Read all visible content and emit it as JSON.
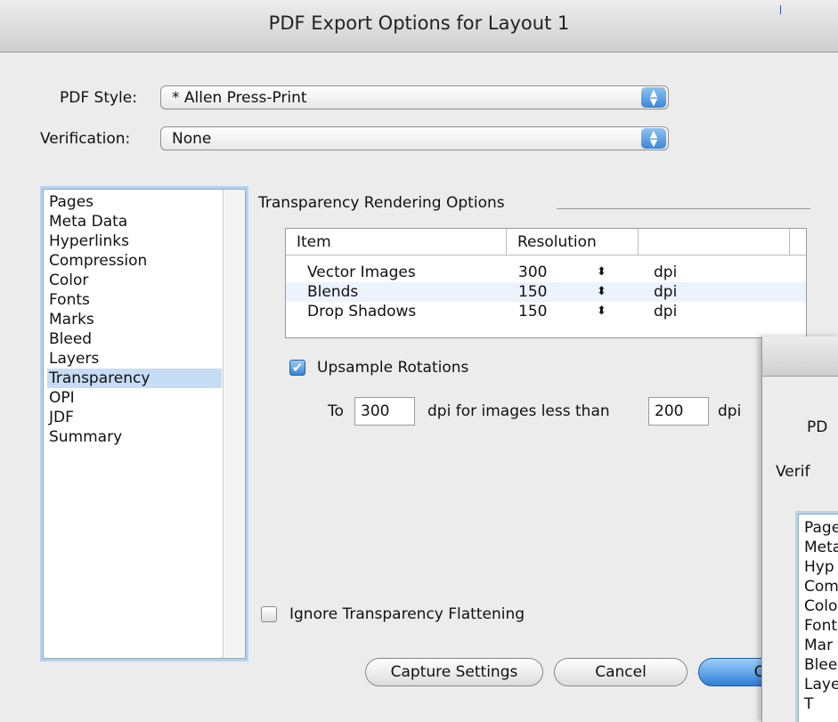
{
  "window": {
    "title": "PDF Export Options for Layout 1"
  },
  "pdf_style": {
    "label": "PDF Style:",
    "value": "* Allen Press-Print"
  },
  "verification": {
    "label": "Verification:",
    "value": "None"
  },
  "categories": [
    {
      "label": "Pages"
    },
    {
      "label": "Meta Data"
    },
    {
      "label": "Hyperlinks"
    },
    {
      "label": "Compression"
    },
    {
      "label": "Color"
    },
    {
      "label": "Fonts"
    },
    {
      "label": "Marks"
    },
    {
      "label": "Bleed"
    },
    {
      "label": "Layers"
    },
    {
      "label": "Transparency",
      "selected": true
    },
    {
      "label": "OPI"
    },
    {
      "label": "JDF"
    },
    {
      "label": "Summary"
    }
  ],
  "transparency": {
    "section_title": "Transparency Rendering Options",
    "columns": {
      "item": "Item",
      "resolution": "Resolution"
    },
    "rows": [
      {
        "item": "Vector Images",
        "value": "300",
        "unit": "dpi"
      },
      {
        "item": "Blends",
        "value": "150",
        "unit": "dpi"
      },
      {
        "item": "Drop Shadows",
        "value": "150",
        "unit": "dpi"
      }
    ],
    "upsample": {
      "label": "Upsample Rotations",
      "checked": true,
      "to_label": "To",
      "to_value": "300",
      "middle_label": "dpi for images less than",
      "less_than_value": "200",
      "end_label": "dpi"
    },
    "ignore_flattening": {
      "label": "Ignore Transparency Flattening",
      "checked": false
    }
  },
  "buttons": {
    "capture": "Capture Settings",
    "cancel": "Cancel",
    "ok": "OK"
  },
  "overlay_dialog": {
    "pdf_label": "PD",
    "verif_label": "Verif",
    "items": [
      "Page",
      "Meta",
      "Hyp",
      "Com",
      "Colo",
      "Font",
      "Mar",
      "Blee",
      "Laye",
      "T"
    ]
  },
  "colors": {
    "selection": "#c7dcf5",
    "aqua_blue": "#3d86d6",
    "focus_ring": "#b5d3f2"
  }
}
